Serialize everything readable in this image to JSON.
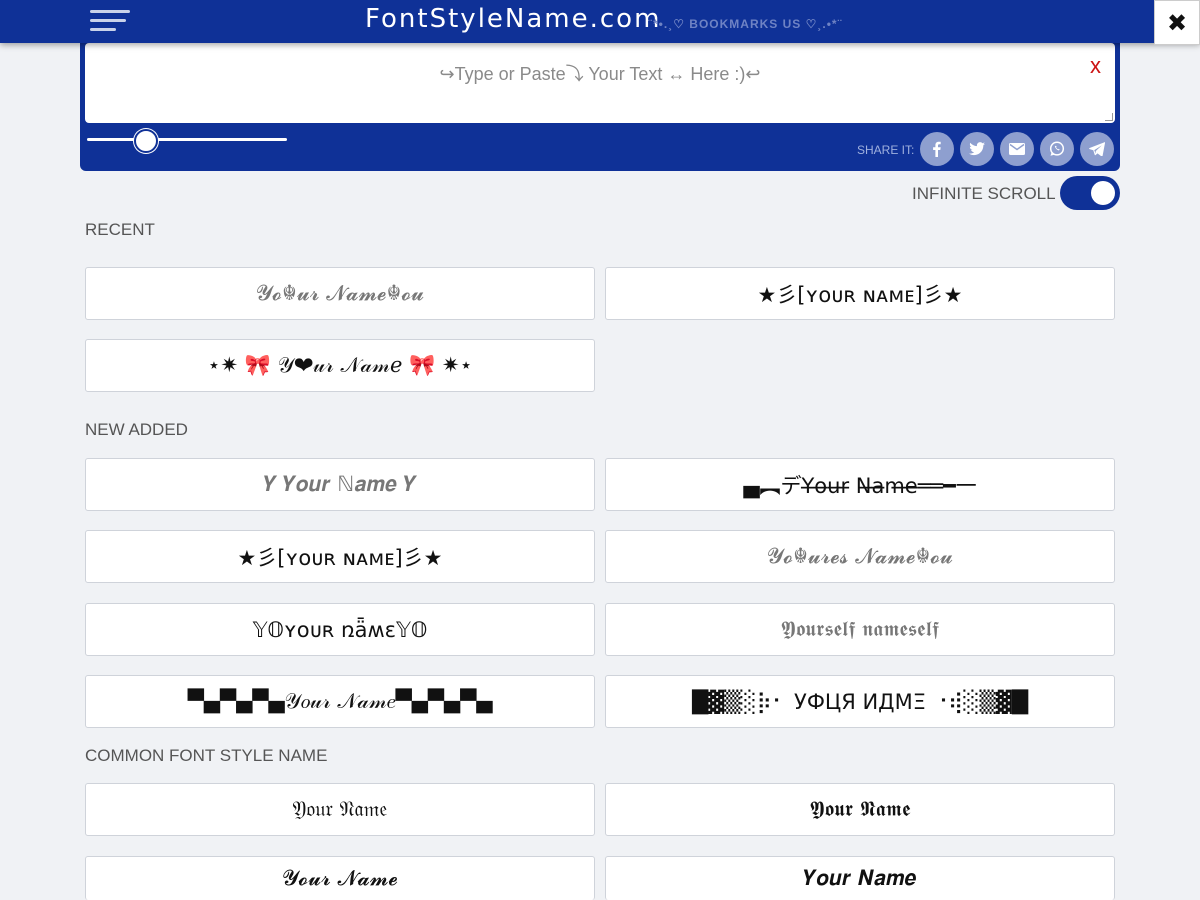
{
  "header": {
    "logo": "FontStyleName.com",
    "bookmark": "¨*•.¸♡ BOOKMARKS US ♡¸.•*¨",
    "close_icon": "close-x-icon",
    "menu_icon": "hamburger-menu-icon"
  },
  "editor": {
    "placeholder": "↪Type or Paste⤵ Your Text ↔ Here :)↩",
    "clear_label": "x",
    "slider_level": 0.3
  },
  "share": {
    "label": "SHARE IT:",
    "buttons": [
      {
        "name": "facebook",
        "glyph": "f"
      },
      {
        "name": "twitter",
        "glyph": "t"
      },
      {
        "name": "email",
        "glyph": "✉"
      },
      {
        "name": "whatsapp",
        "glyph": "✆"
      },
      {
        "name": "telegram",
        "glyph": "➤"
      }
    ]
  },
  "infinite_scroll": {
    "label": "INFINITE SCROLL",
    "enabled": true
  },
  "sections": {
    "recent": {
      "title": "RECENT",
      "items": [
        "𝓨𝓸☬𝓾𝓻 𝓝𝓪𝓶𝓮☬𝓸𝓾",
        "★彡[ʏᴏᴜʀ ɴᴀᴍᴇ]彡★",
        "⋆✷ 🎀 𝒴❤𝓊𝓇 𝒩𝒶𝓂𝑒 🎀 ✷⋆"
      ]
    },
    "new_added": {
      "title": "NEW ADDED",
      "items": [
        "𝒀 𝒀𝒐𝒖𝒓 ℕ𝒂𝒎𝒆 𝒀",
        "▄︻デY̶o̶u̶r̶ N̶a̶m̶e̶══━一",
        "★彡[ʏᴏᴜʀ ɴᴀᴍᴇ]彡★",
        "𝓨𝓸☬𝓾𝓻𝓮𝓼 𝓝𝓪𝓶𝓮☬𝓸𝓾",
        "𝕐𝕆ʏᴏᴜʀ ռǟʍɛ𝕐𝕆",
        "𝖄𝖔𝖚𝖗𝖘𝖊𝖑𝖋 𝖓𝖆𝖒𝖊𝖘𝖊𝖑𝖋",
        "▀▄▀▄▀▄𝒴𝑜𝓊𝓇 𝒩𝒶𝓂𝑒▀▄▀▄▀▄",
        "█▓▒░⡷⠂ УФЦЯ ИДМΞ ⠐⢾░▒▓█"
      ]
    },
    "common": {
      "title": "COMMON FONT STYLE NAME",
      "items": [
        "𝔜𝔬𝔲𝔯 𝔑𝔞𝔪𝔢",
        "𝖄𝖔𝖚𝖗 𝕹𝖆𝖒𝖊",
        "𝓨𝓸𝓾𝓻 𝓝𝓪𝓶𝓮",
        "𝒀𝒐𝒖𝒓 𝑵𝒂𝒎𝒆"
      ]
    }
  },
  "colors": {
    "brand": "#0f3197",
    "clear": "#cc1414",
    "background": "#f0f2f5"
  }
}
